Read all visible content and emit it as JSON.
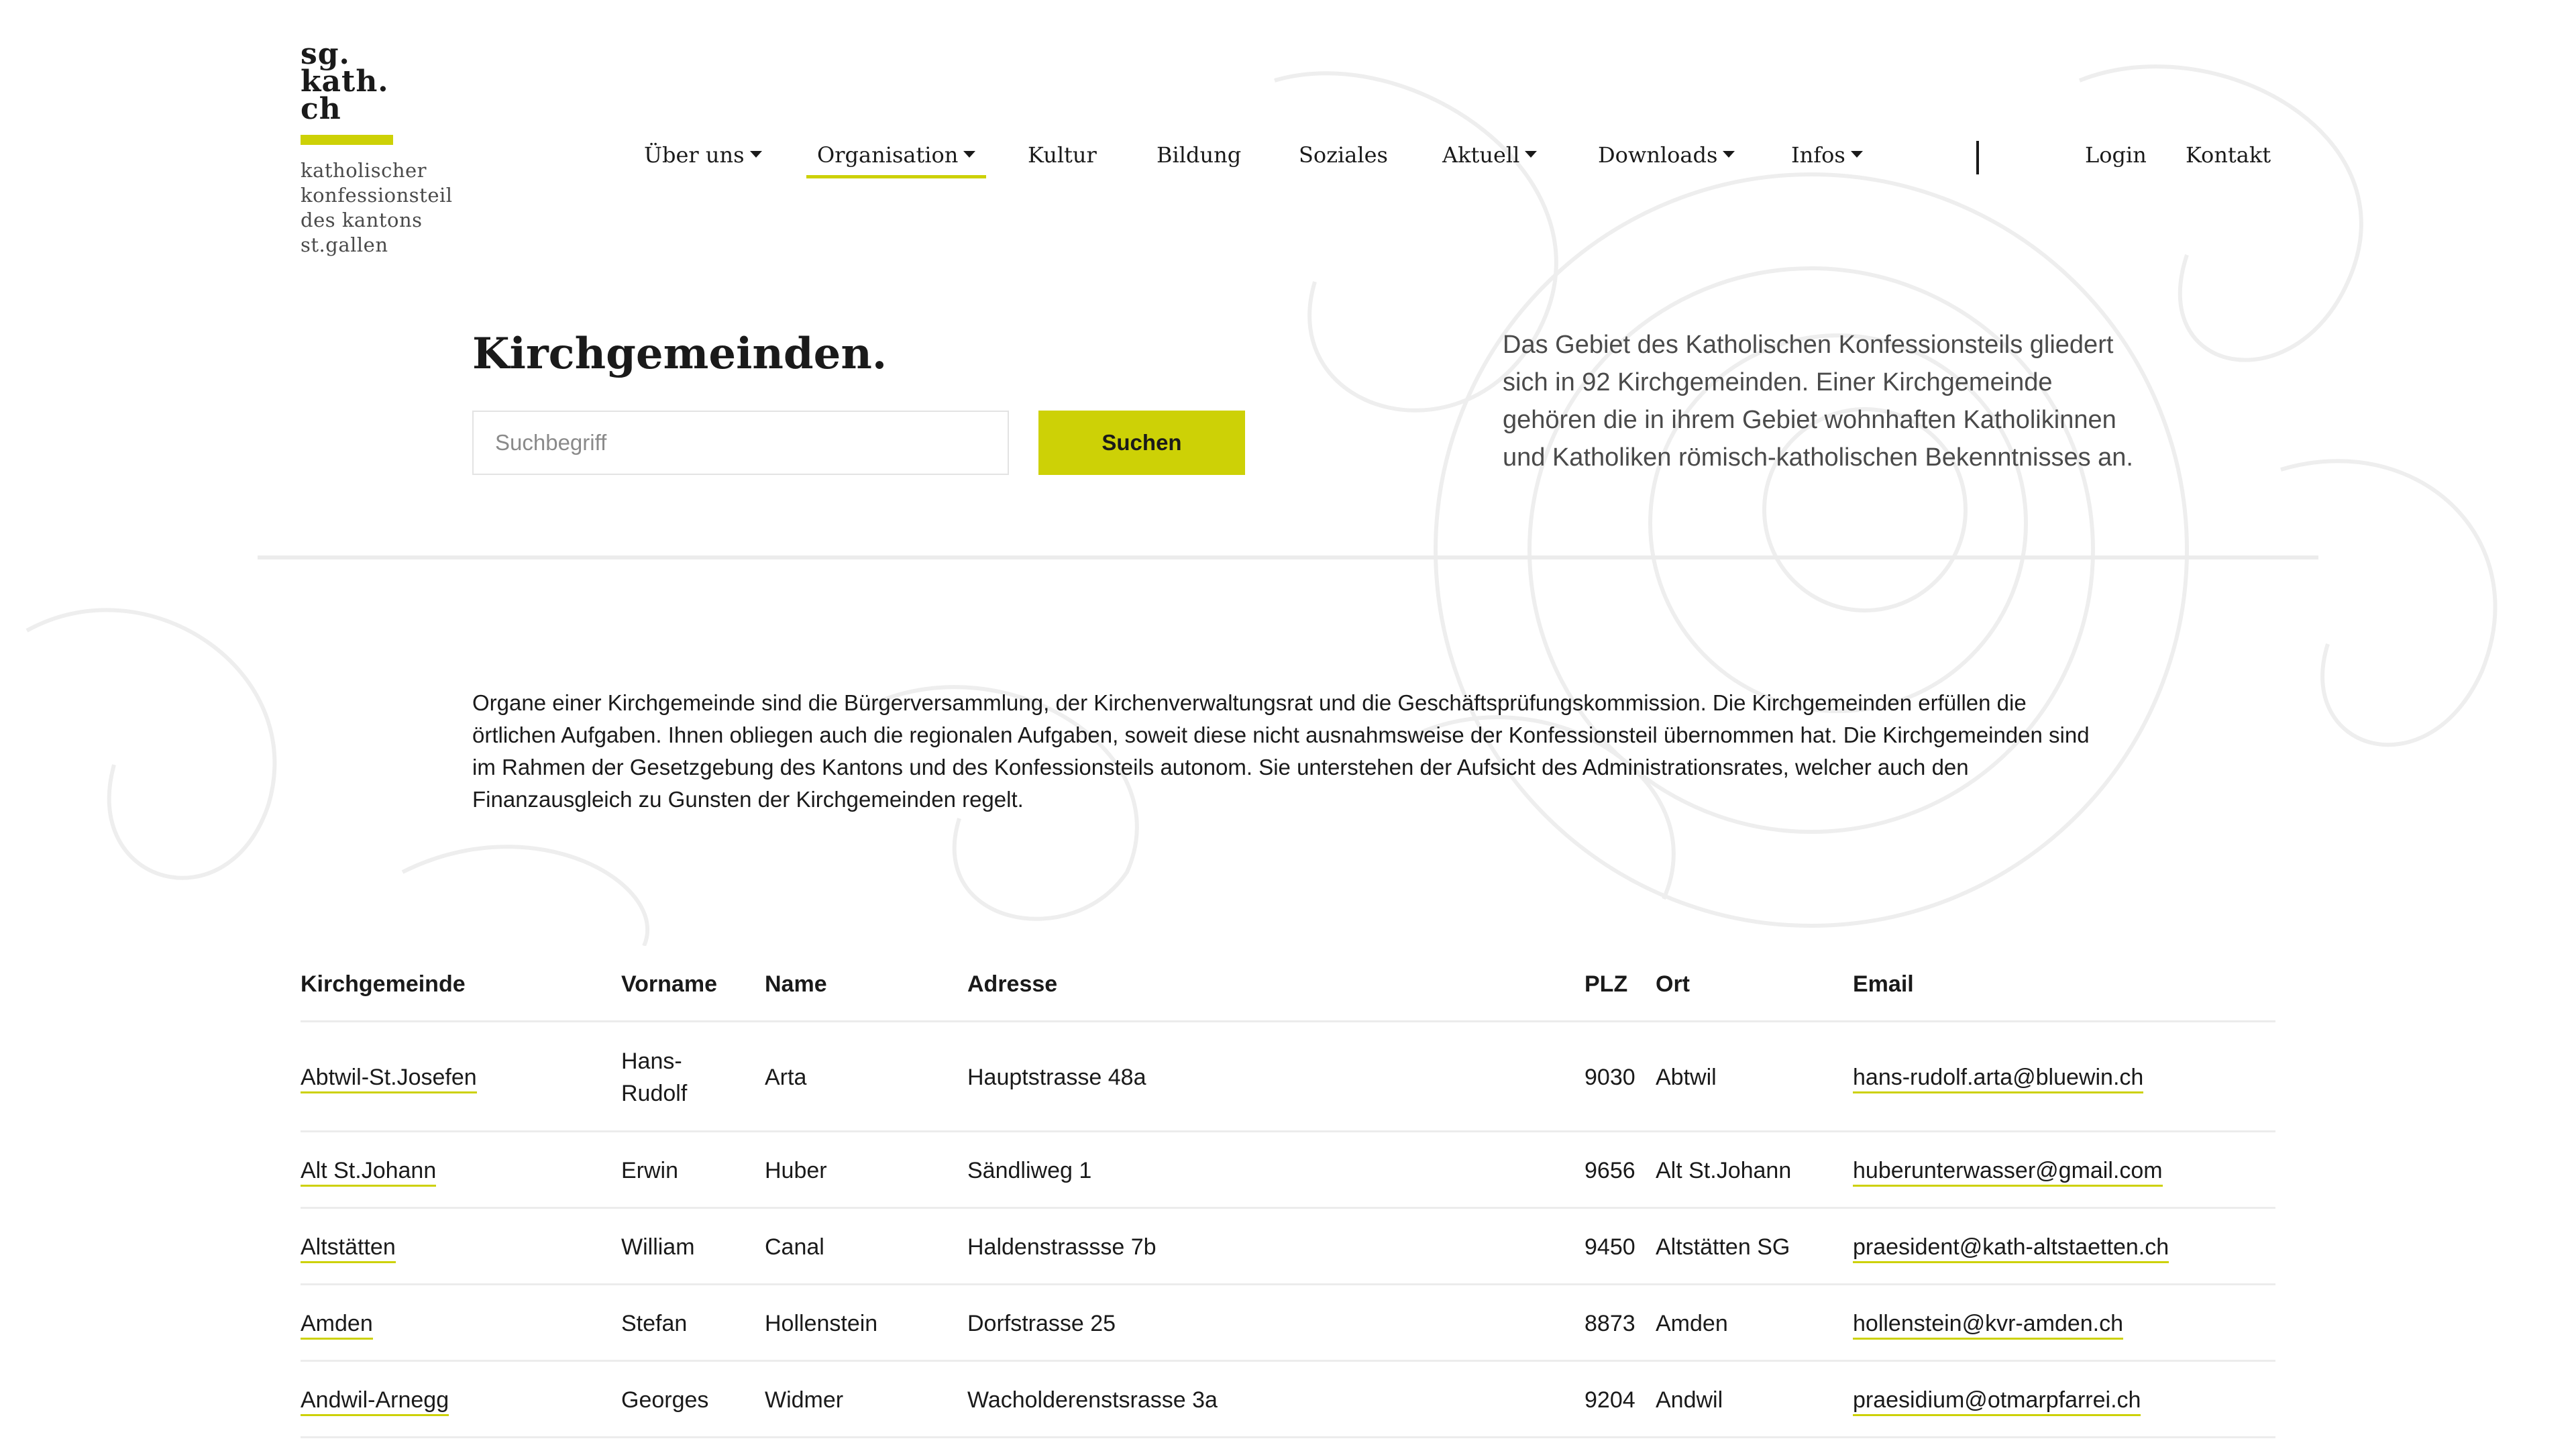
{
  "logo": {
    "line1": "sg.",
    "line2": "kath.",
    "line3": "ch",
    "sub1": "katholischer",
    "sub2": "konfessionsteil",
    "sub3": "des kantons",
    "sub4": "st.gallen",
    "accent": "#cdd106"
  },
  "nav": {
    "items": [
      {
        "label": "Über uns",
        "dropdown": true
      },
      {
        "label": "Organisation",
        "dropdown": true,
        "active": true
      },
      {
        "label": "Kultur",
        "dropdown": false
      },
      {
        "label": "Bildung",
        "dropdown": false
      },
      {
        "label": "Soziales",
        "dropdown": false
      },
      {
        "label": "Aktuell",
        "dropdown": true
      },
      {
        "label": "Downloads",
        "dropdown": true
      },
      {
        "label": "Infos",
        "dropdown": true
      }
    ],
    "login": "Login",
    "contact": "Kontakt"
  },
  "hero": {
    "title": "Kirchgemeinden.",
    "search_placeholder": "Suchbegriff",
    "search_button": "Suchen",
    "intro": "Das Gebiet des Katholischen Konfessionsteils gliedert sich in 92 Kirchgemeinden. Einer Kirchgemeinde gehören die in ihrem Gebiet wohnhaften Katholikinnen und Katholiken römisch-katholischen Bekenntnisses an."
  },
  "body": {
    "text": "Organe einer Kirchgemeinde sind die Bürgerversammlung, der Kirchenverwaltungsrat und die Geschäftsprüfungskommission. Die Kirchgemeinden erfüllen die örtlichen Aufgaben. Ihnen obliegen auch die regionalen Aufgaben, soweit diese nicht ausnahmsweise der Konfessionsteil übernommen hat. Die Kirchgemeinden sind im Rahmen der Gesetzgebung des Kantons und des Konfessionsteils autonom. Sie unterstehen der Aufsicht des Administrationsrates, welcher auch den Finanzausgleich zu Gunsten der Kirchgemeinden regelt."
  },
  "table": {
    "headers": [
      "Kirchgemeinde",
      "Vorname",
      "Name",
      "Adresse",
      "PLZ",
      "Ort",
      "Email"
    ],
    "rows": [
      [
        "Abtwil-St.Josefen",
        "Hans-Rudolf",
        "Arta",
        "Hauptstrasse 48a",
        "9030",
        "Abtwil",
        "hans-rudolf.arta@bluewin.ch"
      ],
      [
        "Alt St.Johann",
        "Erwin",
        "Huber",
        "Sändliweg 1",
        "9656",
        "Alt St.Johann",
        "huberunterwasser@gmail.com"
      ],
      [
        "Altstätten",
        "William",
        "Canal",
        "Haldenstrassse 7b",
        "9450",
        "Altstätten SG",
        "praesident@kath-altstaetten.ch"
      ],
      [
        "Amden",
        "Stefan",
        "Hollenstein",
        "Dorfstrasse 25",
        "8873",
        "Amden",
        "hollenstein@kvr-amden.ch"
      ],
      [
        "Andwil-Arnegg",
        "Georges",
        "Widmer",
        "Wacholderenstsrasse 3a",
        "9204",
        "Andwil",
        "praesidium@otmarpfarrei.ch"
      ]
    ]
  }
}
